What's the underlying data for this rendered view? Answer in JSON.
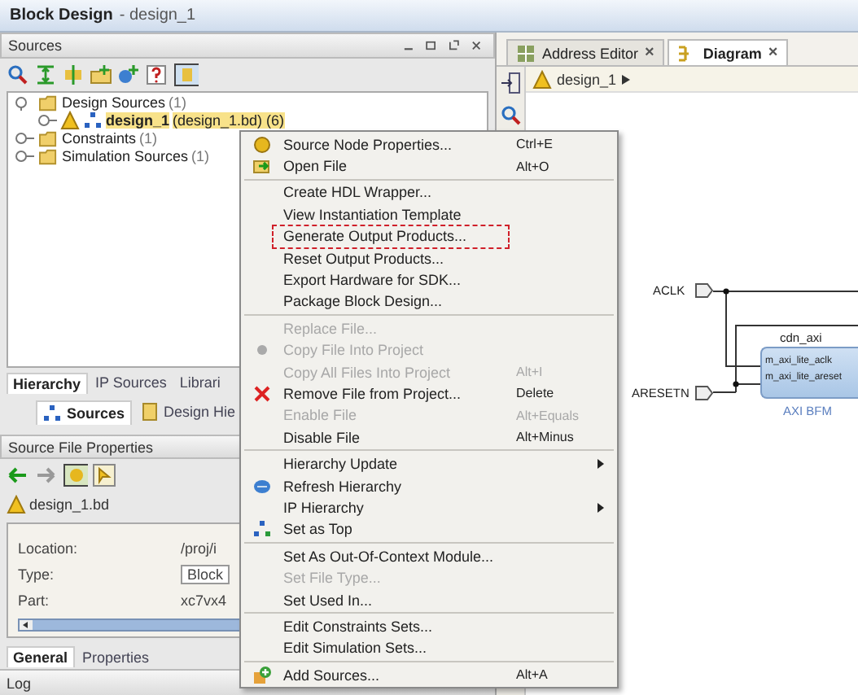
{
  "window": {
    "title": "Block Design",
    "subtitle": "- design_1"
  },
  "sources_panel": {
    "title": "Sources",
    "tree": [
      {
        "label": "Design Sources",
        "count": "(1)",
        "expanded": true,
        "children": [
          {
            "label": "design_1",
            "detail": "(design_1.bd) (6)",
            "selected": true
          }
        ]
      },
      {
        "label": "Constraints",
        "count": "(1)",
        "expanded": false
      },
      {
        "label": "Simulation Sources",
        "count": "(1)",
        "expanded": false
      }
    ],
    "tabs": [
      {
        "label": "Hierarchy",
        "selected": true
      },
      {
        "label": "IP Sources",
        "selected": false
      },
      {
        "label": "Librari",
        "selected": false
      }
    ],
    "subtabs": [
      {
        "label": "Sources",
        "selected": true
      },
      {
        "label": "Design Hie",
        "selected": false
      }
    ]
  },
  "properties_panel": {
    "title": "Source File Properties",
    "file": "design_1.bd",
    "fields": [
      {
        "label": "Location:",
        "value": "/proj/i",
        "kind": "text"
      },
      {
        "label": "Type:",
        "value": "Block",
        "kind": "field"
      },
      {
        "label": "Part:",
        "value": "xc7vx4",
        "kind": "text"
      }
    ],
    "tabs": [
      {
        "label": "General",
        "selected": true
      },
      {
        "label": "Properties",
        "selected": false
      }
    ]
  },
  "log": {
    "title": "Log"
  },
  "editor": {
    "tabs": [
      {
        "label": "Address Editor",
        "close": "×",
        "selected": false
      },
      {
        "label": "Diagram",
        "close": "×",
        "selected": true
      }
    ],
    "breadcrumb": "design_1",
    "diagram": {
      "ports": [
        "ACLK",
        "ARESETN"
      ],
      "block": {
        "name": "cdn_axi",
        "pins": [
          "m_axi_lite_aclk",
          "m_axi_lite_areset"
        ],
        "caption": "AXI BFM"
      }
    }
  },
  "context_menu": {
    "items": [
      {
        "kind": "item",
        "label": "Source Node Properties...",
        "shortcut": "Ctrl+E",
        "disabled": false,
        "submenu": false,
        "annotated": false
      },
      {
        "kind": "item",
        "label": "Open File",
        "shortcut": "Alt+O",
        "disabled": false,
        "submenu": false,
        "annotated": false
      },
      {
        "kind": "separator"
      },
      {
        "kind": "item",
        "label": "Create HDL Wrapper...",
        "disabled": false,
        "submenu": false,
        "annotated": false
      },
      {
        "kind": "item",
        "label": "View Instantiation Template",
        "disabled": false,
        "submenu": false,
        "annotated": false
      },
      {
        "kind": "item",
        "label": "Generate Output Products...",
        "disabled": false,
        "submenu": false,
        "annotated": true
      },
      {
        "kind": "item",
        "label": "Reset Output Products...",
        "disabled": false,
        "submenu": false,
        "annotated": false
      },
      {
        "kind": "item",
        "label": "Export Hardware for SDK...",
        "disabled": false,
        "submenu": false,
        "annotated": false
      },
      {
        "kind": "item",
        "label": "Package Block Design...",
        "disabled": false,
        "submenu": false,
        "annotated": false
      },
      {
        "kind": "separator"
      },
      {
        "kind": "item",
        "label": "Replace File...",
        "disabled": true,
        "submenu": false,
        "annotated": false
      },
      {
        "kind": "item",
        "label": "Copy File Into Project",
        "disabled": true,
        "submenu": false,
        "annotated": false
      },
      {
        "kind": "item",
        "label": "Copy All Files Into Project",
        "shortcut": "Alt+I",
        "disabled": true,
        "submenu": false,
        "annotated": false
      },
      {
        "kind": "item",
        "label": "Remove File from Project...",
        "shortcut": "Delete",
        "disabled": false,
        "submenu": false,
        "annotated": false
      },
      {
        "kind": "item",
        "label": "Enable File",
        "shortcut": "Alt+Equals",
        "disabled": true,
        "submenu": false,
        "annotated": false
      },
      {
        "kind": "item",
        "label": "Disable File",
        "shortcut": "Alt+Minus",
        "disabled": false,
        "submenu": false,
        "annotated": false
      },
      {
        "kind": "separator"
      },
      {
        "kind": "item",
        "label": "Hierarchy Update",
        "disabled": false,
        "submenu": true,
        "annotated": false
      },
      {
        "kind": "item",
        "label": "Refresh Hierarchy",
        "disabled": false,
        "submenu": false,
        "annotated": false
      },
      {
        "kind": "item",
        "label": "IP Hierarchy",
        "disabled": false,
        "submenu": true,
        "annotated": false
      },
      {
        "kind": "item",
        "label": "Set as Top",
        "disabled": false,
        "submenu": false,
        "annotated": false
      },
      {
        "kind": "separator"
      },
      {
        "kind": "item",
        "label": "Set As Out-Of-Context Module...",
        "disabled": false,
        "submenu": false,
        "annotated": false
      },
      {
        "kind": "item",
        "label": "Set File Type...",
        "disabled": true,
        "submenu": false,
        "annotated": false
      },
      {
        "kind": "item",
        "label": "Set Used In...",
        "disabled": false,
        "submenu": false,
        "annotated": false
      },
      {
        "kind": "separator"
      },
      {
        "kind": "item",
        "label": "Edit Constraints Sets...",
        "disabled": false,
        "submenu": false,
        "annotated": false
      },
      {
        "kind": "item",
        "label": "Edit Simulation Sets...",
        "disabled": false,
        "submenu": false,
        "annotated": false
      },
      {
        "kind": "separator"
      },
      {
        "kind": "item",
        "label": "Add Sources...",
        "shortcut": "Alt+A",
        "disabled": false,
        "submenu": false,
        "annotated": false
      }
    ]
  }
}
